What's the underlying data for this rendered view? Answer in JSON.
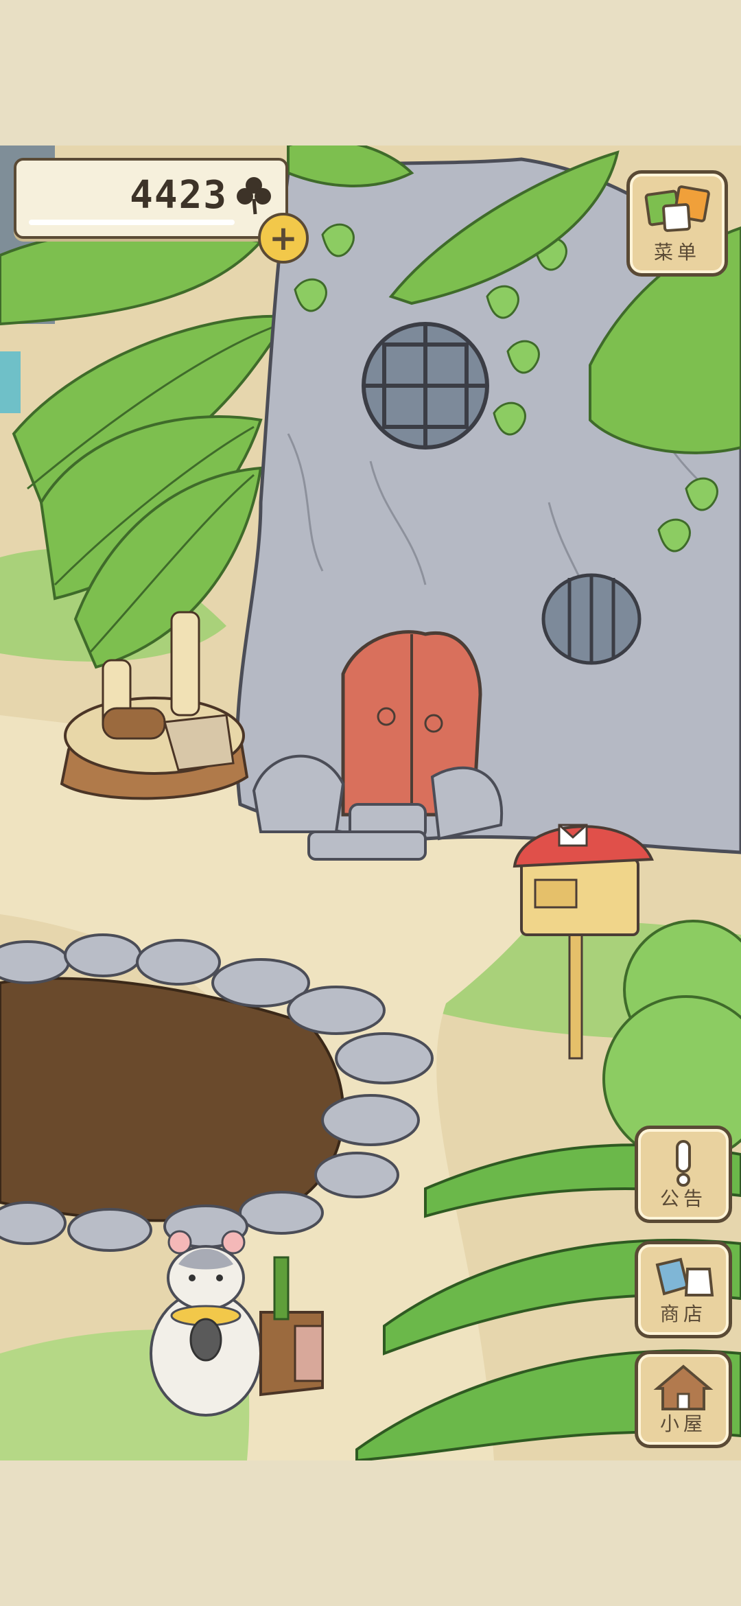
{
  "hud": {
    "clover_count": "4423",
    "clover_icon": "clover-icon",
    "add_icon": "plus-icon"
  },
  "menu": {
    "label": "菜单",
    "icon": "menu-cards-icon"
  },
  "side_buttons": [
    {
      "label": "公告",
      "icon": "exclamation-icon"
    },
    {
      "label": "商店",
      "icon": "shop-bags-icon"
    },
    {
      "label": "小屋",
      "icon": "house-icon"
    }
  ],
  "colors": {
    "background": "#e8dfc4",
    "leaf": "#7dbf4f",
    "rock": "#b4b8c2",
    "door": "#d9705c",
    "mailbox": "#e0504a",
    "soil": "#6a4a2c"
  }
}
